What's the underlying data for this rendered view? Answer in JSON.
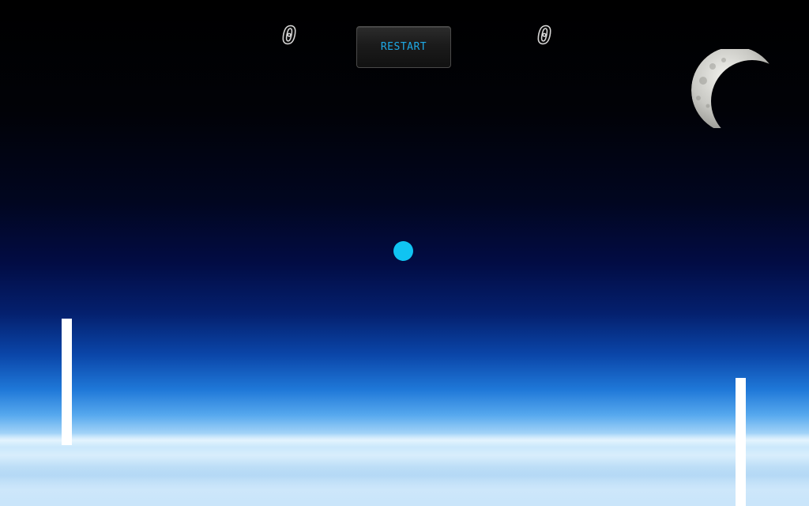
{
  "scoreboard": {
    "left_score": "0",
    "right_score": "0"
  },
  "controls": {
    "restart_label": "RESTART"
  },
  "colors": {
    "ball": "#10c4f2",
    "paddle": "#ffffff",
    "restart_text": "#1ea9e6"
  },
  "scene": {
    "background": "earth-horizon-space",
    "decoration": "crescent-moon"
  }
}
